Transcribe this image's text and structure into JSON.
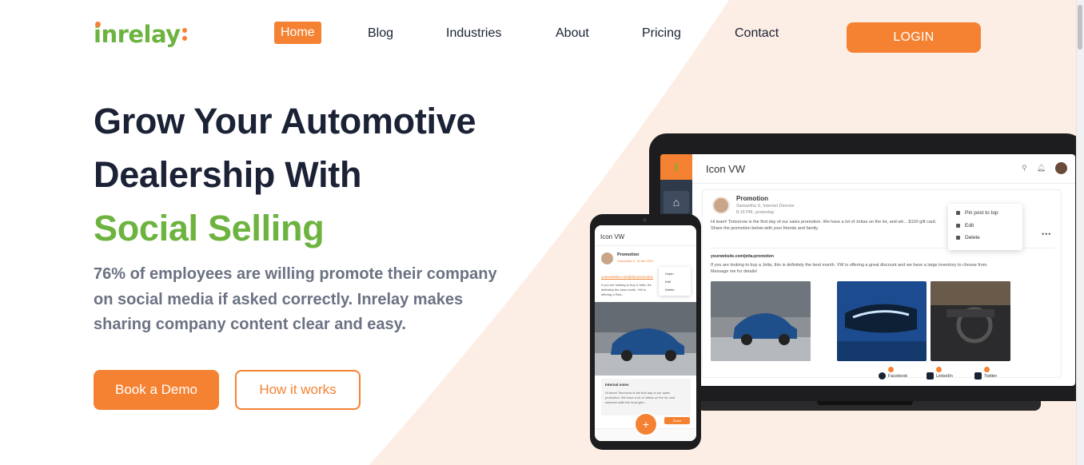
{
  "brand": {
    "name": "inrelay",
    "accent": "#f58233",
    "green": "#6db33f",
    "dark": "#1b2236"
  },
  "nav": {
    "items": [
      {
        "label": "Home",
        "active": true
      },
      {
        "label": "Blog"
      },
      {
        "label": "Industries"
      },
      {
        "label": "About"
      },
      {
        "label": "Pricing"
      },
      {
        "label": "Contact"
      }
    ],
    "login_label": "LOGIN"
  },
  "hero": {
    "title_line1": "Grow Your Automotive",
    "title_line2": "Dealership With",
    "title_highlight": "Social Selling",
    "subtitle": "76% of employees are willing promote their company on social media if asked correctly. Inrelay makes sharing company content clear and easy.",
    "cta_primary": "Book a Demo",
    "cta_secondary": "How it works"
  },
  "laptop_app": {
    "title": "Icon VW",
    "post_title": "Promotion",
    "author": "Samantha S, Internet Director",
    "time": "8:15 PM, yesterday",
    "text": "Hi team! Tomorrow is the first day of our sales promotion. We have a lot of Jettas on the lot, and wh... $100 gift card. Share the promotion below with your friends and family.",
    "link": "yourwebsite.com/jetta-promotion",
    "link_text": "If you are looking to buy a Jetta, this is definitely the best month. VW is offering a great discount and we have a large inventory to choose from. Message me for details!",
    "menu": [
      "Pin post to top",
      "Edit",
      "Delete"
    ],
    "social": [
      "Facebook",
      "LinkedIn",
      "Twitter"
    ]
  },
  "phone_app": {
    "title": "Icon VW",
    "post_title": "Promotion",
    "meta": "Samantha S, 16 feb 2021",
    "link": "yourwebsite.com/jetta-promotion",
    "text": "If you are looking to buy a Jetta. It's definitely the best month. VW is offering a Rea...",
    "menu": [
      "Unpin",
      "Edit",
      "Delete"
    ],
    "notes_title": "Internal notes",
    "notes_text": "Hi team! Tomorrow is the first day of our sales promotion. We have a lot of Jettas on the lot, and whoever sells the most gil's...",
    "share": "Share"
  }
}
